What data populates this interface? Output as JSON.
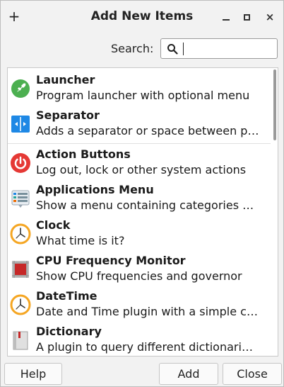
{
  "window": {
    "title": "Add New Items",
    "add_glyph": "+",
    "close_glyph": "×"
  },
  "search": {
    "label": "Search:",
    "value": "",
    "placeholder": ""
  },
  "items": [
    {
      "name": "Launcher",
      "description": "Program launcher with optional menu",
      "icon": "rocket-icon"
    },
    {
      "name": "Separator",
      "description": "Adds a separator or space between p…",
      "icon": "separator-icon"
    },
    {
      "name": "Action Buttons",
      "description": "Log out, lock or other system actions",
      "icon": "power-icon"
    },
    {
      "name": "Applications Menu",
      "description": "Show a menu containing categories …",
      "icon": "menu-icon"
    },
    {
      "name": "Clock",
      "description": "What time is it?",
      "icon": "clock-icon"
    },
    {
      "name": "CPU Frequency Monitor",
      "description": "Show CPU frequencies and governor",
      "icon": "cpu-icon"
    },
    {
      "name": "DateTime",
      "description": "Date and Time plugin with a simple c…",
      "icon": "clock-icon"
    },
    {
      "name": "Dictionary",
      "description": "A plugin to query different dictionari…",
      "icon": "book-icon"
    }
  ],
  "footer": {
    "help_label": "Help",
    "add_label": "Add",
    "close_label": "Close"
  },
  "colors": {
    "accent_green": "#4caf50",
    "accent_blue": "#1e88e5",
    "accent_red": "#e53935",
    "accent_orange": "#f5a623",
    "cpu_red": "#c62828"
  }
}
